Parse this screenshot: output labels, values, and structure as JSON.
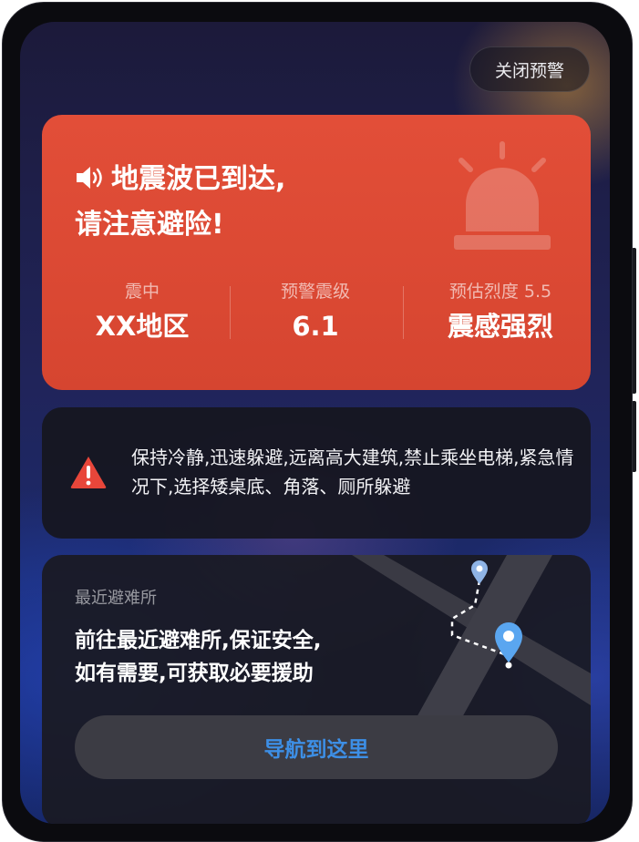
{
  "header": {
    "close_button_label": "关闭预警"
  },
  "alert": {
    "title_line1": "地震波已到达,",
    "title_line2": "请注意避险!",
    "stats": [
      {
        "label": "震中",
        "value": "XX地区"
      },
      {
        "label": "预警震级",
        "value": "6.1"
      },
      {
        "label": "预估烈度 5.5",
        "value": "震感强烈"
      }
    ],
    "colors": {
      "card": "#e24e38"
    }
  },
  "tip": {
    "text": "保持冷静,迅速躲避,远离高大建筑,禁止乘坐电梯,紧急情况下,选择矮桌底、角落、厕所躲避",
    "icon": "warning-triangle-icon",
    "icon_color": "#e8463a"
  },
  "shelter": {
    "label": "最近避难所",
    "title_line1": "前往最近避难所,保证安全,",
    "title_line2": "如有需要,可获取必要援助",
    "nav_button_label": "导航到这里",
    "accent": "#3d8fe6"
  }
}
